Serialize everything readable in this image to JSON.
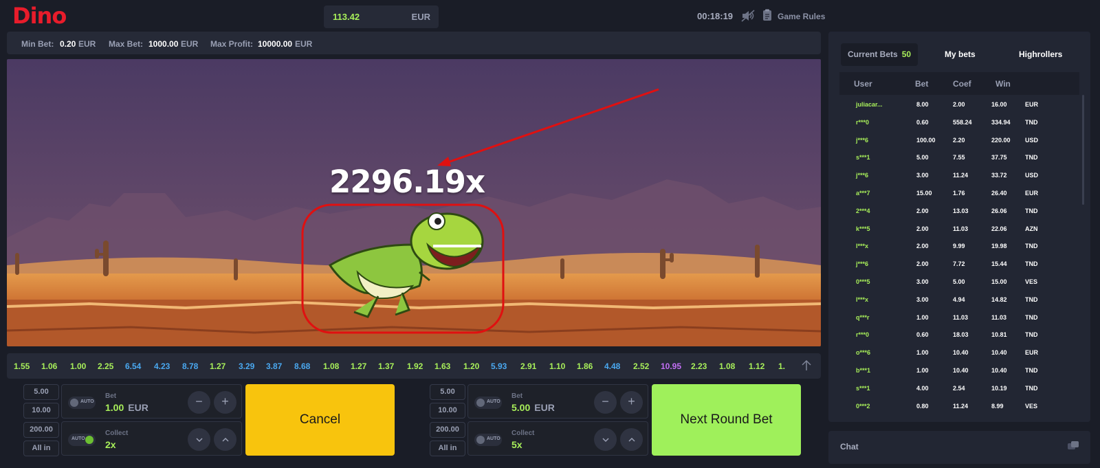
{
  "app": {
    "title": "Dino"
  },
  "header": {
    "balance": "113.42",
    "currency": "EUR",
    "clock": "00:18:19",
    "rules_label": "Game Rules"
  },
  "limits": {
    "min_label": "Min Bet:",
    "min_value": "0.20",
    "min_cur": "EUR",
    "max_label": "Max Bet:",
    "max_value": "1000.00",
    "max_cur": "EUR",
    "profit_label": "Max Profit:",
    "profit_value": "10000.00",
    "profit_cur": "EUR"
  },
  "game": {
    "multiplier": "2296.19x"
  },
  "history": [
    {
      "v": "1.55",
      "c": "#a8ef5a"
    },
    {
      "v": "1.06",
      "c": "#a8ef5a"
    },
    {
      "v": "1.00",
      "c": "#a8ef5a"
    },
    {
      "v": "2.25",
      "c": "#a8ef5a"
    },
    {
      "v": "6.54",
      "c": "#4aa8f0"
    },
    {
      "v": "4.23",
      "c": "#4aa8f0"
    },
    {
      "v": "8.78",
      "c": "#4aa8f0"
    },
    {
      "v": "1.27",
      "c": "#a8ef5a"
    },
    {
      "v": "3.29",
      "c": "#4aa8f0"
    },
    {
      "v": "3.87",
      "c": "#4aa8f0"
    },
    {
      "v": "8.68",
      "c": "#4aa8f0"
    },
    {
      "v": "1.08",
      "c": "#a8ef5a"
    },
    {
      "v": "1.27",
      "c": "#a8ef5a"
    },
    {
      "v": "1.37",
      "c": "#a8ef5a"
    },
    {
      "v": "1.92",
      "c": "#a8ef5a"
    },
    {
      "v": "1.63",
      "c": "#a8ef5a"
    },
    {
      "v": "1.20",
      "c": "#a8ef5a"
    },
    {
      "v": "5.93",
      "c": "#4aa8f0"
    },
    {
      "v": "2.91",
      "c": "#a8ef5a"
    },
    {
      "v": "1.10",
      "c": "#a8ef5a"
    },
    {
      "v": "1.86",
      "c": "#a8ef5a"
    },
    {
      "v": "4.48",
      "c": "#4aa8f0"
    },
    {
      "v": "2.52",
      "c": "#a8ef5a"
    },
    {
      "v": "10.95",
      "c": "#c36ff5"
    },
    {
      "v": "2.23",
      "c": "#a8ef5a"
    },
    {
      "v": "1.08",
      "c": "#a8ef5a"
    },
    {
      "v": "1.12",
      "c": "#a8ef5a"
    },
    {
      "v": "1.",
      "c": "#a8ef5a"
    }
  ],
  "panel1": {
    "quick": [
      "5.00",
      "10.00",
      "200.00",
      "All in"
    ],
    "auto_label": "AUTO",
    "bet_label": "Bet",
    "bet_value": "1.00",
    "bet_cur": "EUR",
    "collect_label": "Collect",
    "collect_value": "2x",
    "action_label": "Cancel"
  },
  "panel2": {
    "quick": [
      "5.00",
      "10.00",
      "200.00",
      "All in"
    ],
    "auto_label": "AUTO",
    "bet_label": "Bet",
    "bet_value": "5.00",
    "bet_cur": "EUR",
    "collect_label": "Collect",
    "collect_value": "5x",
    "action_label": "Next Round Bet"
  },
  "bets": {
    "tabs": [
      "Current Bets",
      "My bets",
      "Highrollers"
    ],
    "count": "50",
    "headers": [
      "User",
      "Bet",
      "Coef",
      "Win"
    ],
    "rows": [
      [
        "juliacar...",
        "8.00",
        "2.00",
        "16.00",
        "EUR"
      ],
      [
        "r***0",
        "0.60",
        "558.24",
        "334.94",
        "TND"
      ],
      [
        "j***6",
        "100.00",
        "2.20",
        "220.00",
        "USD"
      ],
      [
        "s***1",
        "5.00",
        "7.55",
        "37.75",
        "TND"
      ],
      [
        "j***6",
        "3.00",
        "11.24",
        "33.72",
        "USD"
      ],
      [
        "a***7",
        "15.00",
        "1.76",
        "26.40",
        "EUR"
      ],
      [
        "2***4",
        "2.00",
        "13.03",
        "26.06",
        "TND"
      ],
      [
        "k***5",
        "2.00",
        "11.03",
        "22.06",
        "AZN"
      ],
      [
        "l***x",
        "2.00",
        "9.99",
        "19.98",
        "TND"
      ],
      [
        "j***6",
        "2.00",
        "7.72",
        "15.44",
        "TND"
      ],
      [
        "0***5",
        "3.00",
        "5.00",
        "15.00",
        "VES"
      ],
      [
        "l***x",
        "3.00",
        "4.94",
        "14.82",
        "TND"
      ],
      [
        "q***r",
        "1.00",
        "11.03",
        "11.03",
        "TND"
      ],
      [
        "r***0",
        "0.60",
        "18.03",
        "10.81",
        "TND"
      ],
      [
        "o***6",
        "1.00",
        "10.40",
        "10.40",
        "EUR"
      ],
      [
        "b***1",
        "1.00",
        "10.40",
        "10.40",
        "TND"
      ],
      [
        "s***1",
        "4.00",
        "2.54",
        "10.19",
        "TND"
      ],
      [
        "0***2",
        "0.80",
        "11.24",
        "8.99",
        "VES"
      ]
    ]
  },
  "chat": {
    "label": "Chat"
  }
}
